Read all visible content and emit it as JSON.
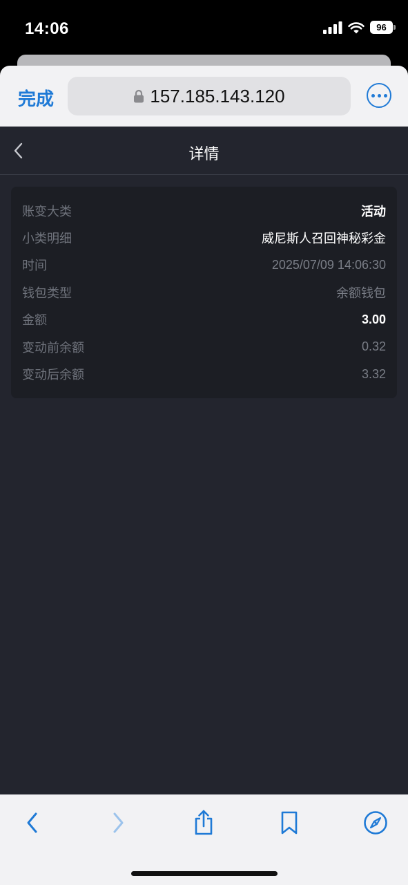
{
  "status_bar": {
    "time": "14:06",
    "battery": "96"
  },
  "browser": {
    "done_label": "完成",
    "url": "157.185.143.120"
  },
  "page": {
    "title": "详情",
    "rows": [
      {
        "label": "账变大类",
        "value": "活动"
      },
      {
        "label": "小类明细",
        "value": "威尼斯人召回神秘彩金"
      },
      {
        "label": "时间",
        "value": "2025/07/09 14:06:30"
      },
      {
        "label": "钱包类型",
        "value": "余额钱包"
      },
      {
        "label": "金额",
        "value": "3.00"
      },
      {
        "label": "变动前余额",
        "value": "0.32"
      },
      {
        "label": "变动后余额",
        "value": "3.32"
      }
    ]
  },
  "colors": {
    "accent": "#1f7ad6",
    "page_background": "#23252e",
    "card_background": "#1c1e24"
  },
  "icons": {
    "signal": "cellular-signal-icon",
    "wifi": "wifi-icon",
    "lock": "lock-icon",
    "more": "ellipsis-circle-icon",
    "back": "chevron-left-icon",
    "share": "share-icon",
    "bookmarks": "bookmark-icon",
    "safari": "compass-icon"
  }
}
